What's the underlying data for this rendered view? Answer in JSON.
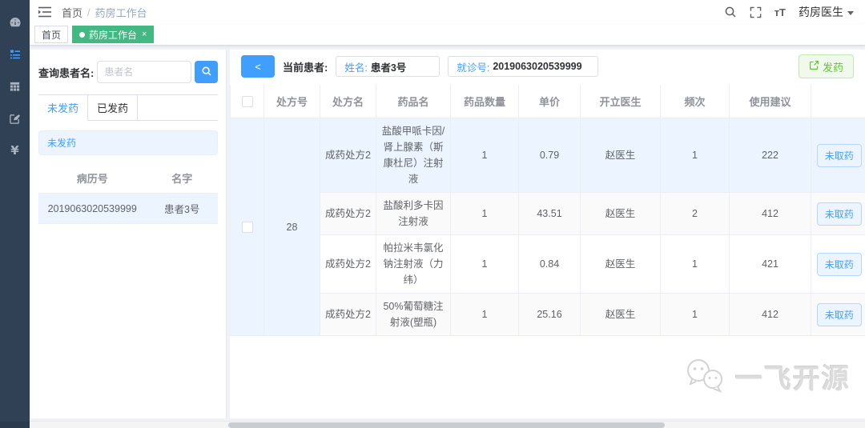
{
  "header": {
    "breadcrumb": {
      "home": "首页",
      "separator": "/",
      "current": "药房工作台"
    },
    "user": {
      "name": "药房医生"
    },
    "font_icon_text": "тT"
  },
  "tags_view": {
    "tabs": [
      {
        "label": "首页",
        "active": false
      },
      {
        "label": "药房工作台",
        "active": true,
        "close": "×"
      }
    ]
  },
  "sidebar": {
    "icons": [
      "dashboard-icon",
      "worklist-icon",
      "table-icon",
      "edit-icon",
      "yen-icon"
    ],
    "yen_glyph": "¥"
  },
  "left_panel": {
    "query_label": "查询患者名:",
    "query_placeholder": "患者名",
    "tabs": {
      "undispensed": "未发药",
      "dispensed": "已发药"
    },
    "banner": "未发药",
    "patient_table": {
      "headers": [
        "病历号",
        "名字"
      ],
      "rows": [
        {
          "record_no": "2019063020539999",
          "name": "患者3号"
        }
      ]
    }
  },
  "patient_bar": {
    "back_glyph": "<",
    "current_label": "当前患者:",
    "name_label": "姓名:",
    "name_value": "患者3号",
    "visit_label": "就诊号:",
    "visit_value": "2019063020539999",
    "dispense_label": "发药"
  },
  "prescription_table": {
    "headers": [
      "处方号",
      "处方名",
      "药品名",
      "药品数量",
      "单价",
      "开立医生",
      "频次",
      "使用建议"
    ],
    "group": {
      "prescription_no": "28"
    },
    "rows": [
      {
        "type": "成药处方2",
        "drug": "盐酸甲哌卡因/肾上腺素（斯康杜尼）注射液",
        "qty": "1",
        "price": "0.79",
        "doctor": "赵医生",
        "freq": "1",
        "advice": "222",
        "status": "未取药"
      },
      {
        "type": "成药处方2",
        "drug": "盐酸利多卡因注射液",
        "qty": "1",
        "price": "43.51",
        "doctor": "赵医生",
        "freq": "2",
        "advice": "412",
        "status": "未取药"
      },
      {
        "type": "成药处方2",
        "drug": "帕拉米韦氯化钠注射液（力纬）",
        "qty": "1",
        "price": "0.84",
        "doctor": "赵医生",
        "freq": "1",
        "advice": "421",
        "status": "未取药"
      },
      {
        "type": "成药处方2",
        "drug": "50%葡萄糖注射液(塑瓶)",
        "qty": "1",
        "price": "25.16",
        "doctor": "赵医生",
        "freq": "1",
        "advice": "412",
        "status": "未取药"
      }
    ]
  },
  "watermark": {
    "text": "一飞开源"
  },
  "colors": {
    "primary": "#409EFF",
    "success": "#67C23A",
    "tab_active_green": "#42b983",
    "sidebar_bg": "#304156",
    "selected_row_bg": "#ecf5ff",
    "content_bg": "#f0f2f5"
  }
}
